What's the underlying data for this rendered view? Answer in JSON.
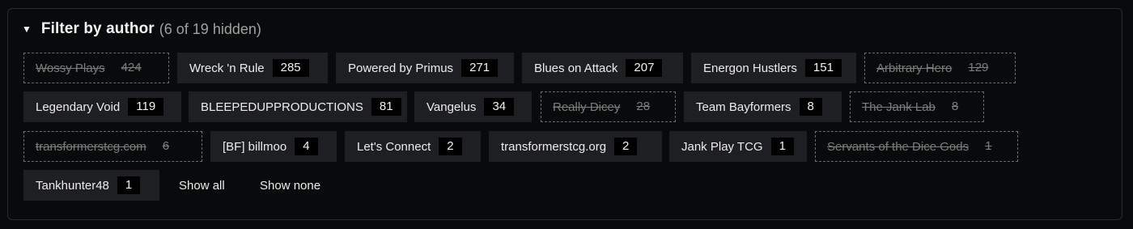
{
  "filter": {
    "caret_icon": "triangle-down-icon",
    "title": "Filter by author",
    "hidden_summary": "(6 of 19 hidden)",
    "authors": [
      {
        "name": "Wossy Plays",
        "count": "424",
        "hidden": true
      },
      {
        "name": "Wreck 'n Rule",
        "count": "285",
        "hidden": false
      },
      {
        "name": "Powered by Primus",
        "count": "271",
        "hidden": false
      },
      {
        "name": "Blues on Attack",
        "count": "207",
        "hidden": false
      },
      {
        "name": "Energon Hustlers",
        "count": "151",
        "hidden": false
      },
      {
        "name": "Arbitrary Hero",
        "count": "129",
        "hidden": true
      },
      {
        "name": "Legendary Void",
        "count": "119",
        "hidden": false
      },
      {
        "name": "BLEEPEDUPPRODUCTIONS",
        "count": "81",
        "hidden": false
      },
      {
        "name": "Vangelus",
        "count": "34",
        "hidden": false
      },
      {
        "name": "Really Dicey",
        "count": "28",
        "hidden": true
      },
      {
        "name": "Team Bayformers",
        "count": "8",
        "hidden": false
      },
      {
        "name": "The Jank Lab",
        "count": "8",
        "hidden": true
      },
      {
        "name": "transformerstcg.com",
        "count": "6",
        "hidden": true
      },
      {
        "name": "[BF] billmoo",
        "count": "4",
        "hidden": false
      },
      {
        "name": "Let's Connect",
        "count": "2",
        "hidden": false
      },
      {
        "name": "transformerstcg.org",
        "count": "2",
        "hidden": false
      },
      {
        "name": "Jank Play TCG",
        "count": "1",
        "hidden": false
      },
      {
        "name": "Servants of the Dice Gods",
        "count": "1",
        "hidden": true
      },
      {
        "name": "Tankhunter48",
        "count": "1",
        "hidden": false
      }
    ],
    "show_all_label": "Show all",
    "show_none_label": "Show none"
  }
}
